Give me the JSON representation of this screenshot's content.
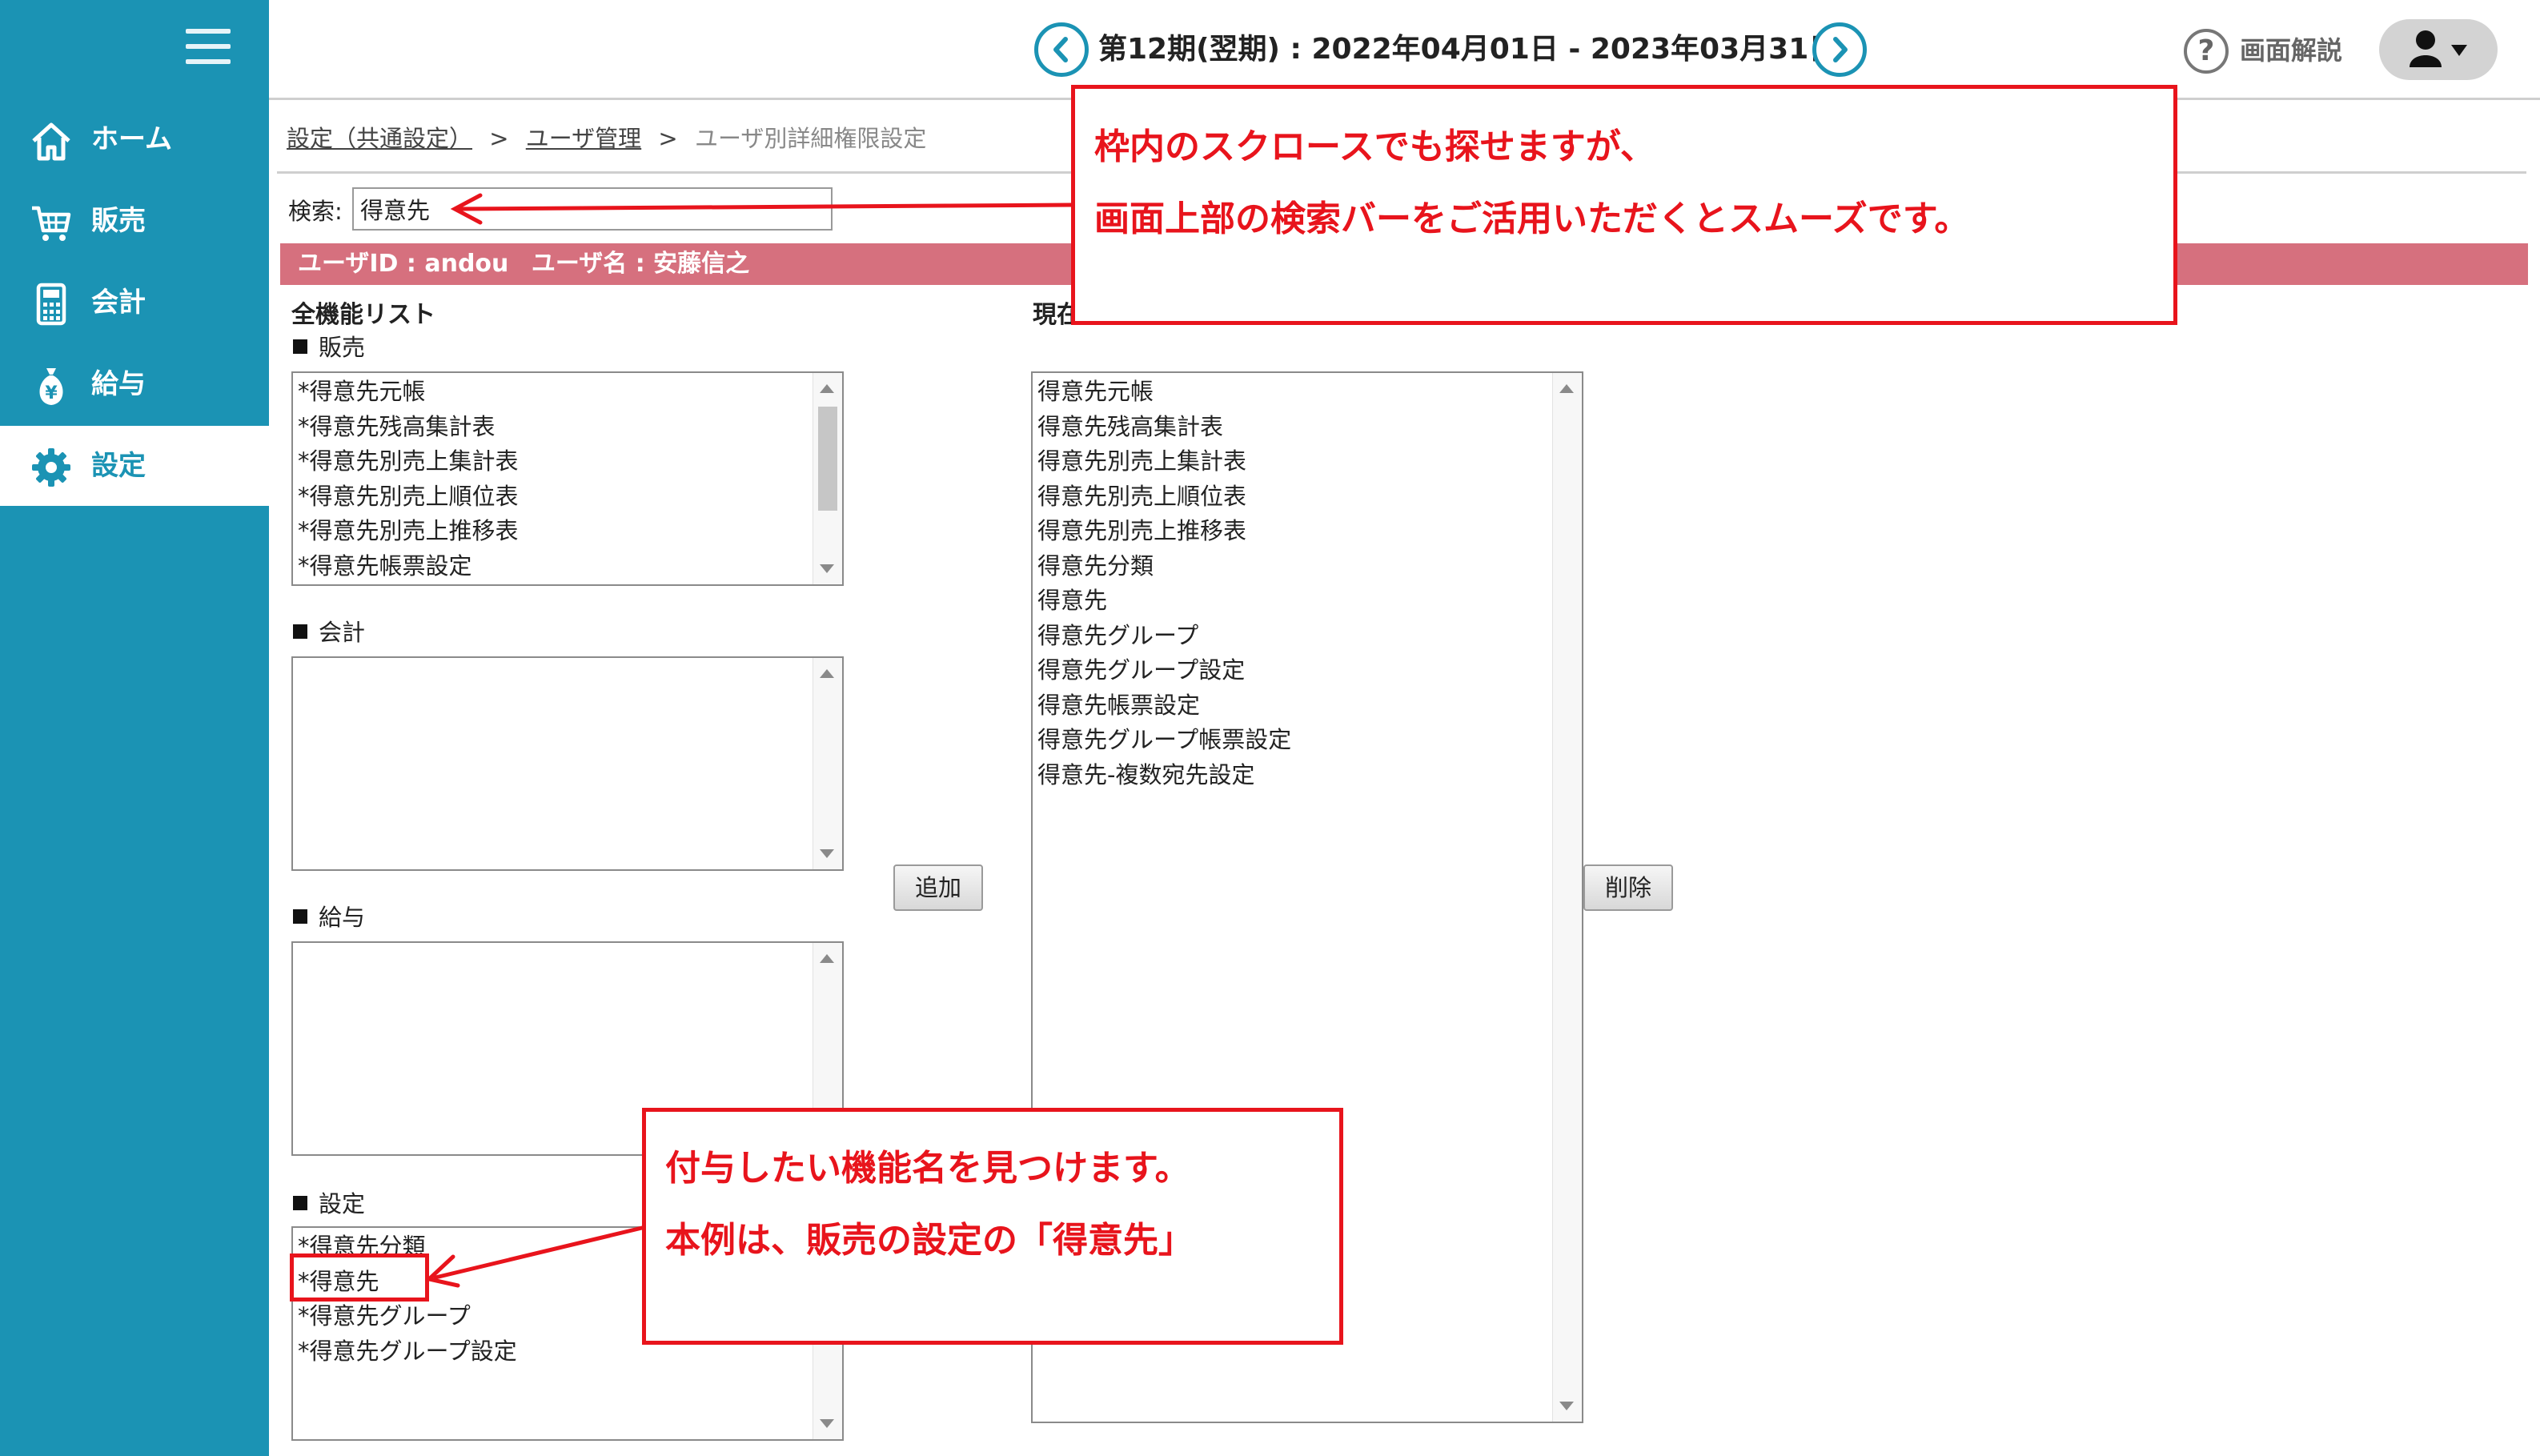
{
  "header": {
    "period": "第12期(翌期) : 2022年04月01日 - 2023年03月31日",
    "help_label": "画面解説",
    "help_glyph": "?"
  },
  "sidebar": {
    "items": [
      {
        "label": "ホーム",
        "icon": "home-icon"
      },
      {
        "label": "販売",
        "icon": "cart-icon"
      },
      {
        "label": "会計",
        "icon": "calculator-icon"
      },
      {
        "label": "給与",
        "icon": "money-bag-icon"
      },
      {
        "label": "設定",
        "icon": "gear-icon",
        "active": true
      }
    ],
    "yen_glyph": "¥"
  },
  "breadcrumb": {
    "items": [
      "設定（共通設定）",
      "ユーザ管理",
      "ユーザ別詳細権限設定"
    ],
    "separator": ">"
  },
  "search": {
    "label": "検索:",
    "value": "得意先"
  },
  "user_bar": {
    "user_id": "ユーザID : andou",
    "user_name": "ユーザ名 : 安藤信之"
  },
  "all_functions": {
    "heading": "全機能リスト",
    "categories": [
      {
        "name": "販売",
        "items": [
          "*得意先元帳",
          "*得意先残高集計表",
          "*得意先別売上集計表",
          "*得意先別売上順位表",
          "*得意先別売上推移表",
          "*得意先帳票設定"
        ]
      },
      {
        "name": "会計",
        "items": []
      },
      {
        "name": "給与",
        "items": []
      },
      {
        "name": "設定",
        "items": [
          "*得意先分類",
          "*得意先",
          "*得意先グループ",
          "*得意先グループ設定"
        ]
      }
    ]
  },
  "current": {
    "heading": "現在",
    "items": [
      "得意先元帳",
      "得意先残高集計表",
      "得意先別売上集計表",
      "得意先別売上順位表",
      "得意先別売上推移表",
      "得意先分類",
      "得意先",
      "得意先グループ",
      "得意先グループ設定",
      "得意先帳票設定",
      "得意先グループ帳票設定",
      "得意先-複数宛先設定"
    ]
  },
  "buttons": {
    "add": "追加",
    "remove": "削除"
  },
  "annotations": {
    "callout_top": [
      "枠内のスクロースでも探せますが、",
      "画面上部の検索バーをご活用いただくとスムーズです。"
    ],
    "callout_bottom": [
      "付与したい機能名を見つけます。",
      "本例は、販売の設定の「得意先」"
    ]
  },
  "colors": {
    "sidebar": "#1b93b4",
    "user_bar": "#d6707e",
    "annotation": "#e8141c"
  }
}
